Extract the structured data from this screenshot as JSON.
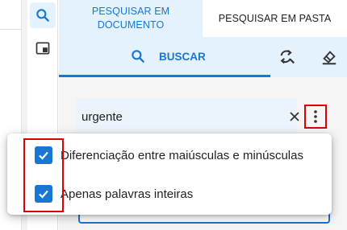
{
  "tabs": [
    {
      "label": "PESQUISAR EM DOCUMENTO",
      "active": true
    },
    {
      "label": "PESQUISAR EM PASTA",
      "active": false
    }
  ],
  "toolbar": {
    "search_label": "BUSCAR",
    "replace_icon": "find-replace-icon",
    "clear_icon": "eraser-icon"
  },
  "search": {
    "value": "urgente"
  },
  "options_menu": {
    "items": [
      {
        "label": "Diferenciação entre maiúsculas e minúsculas",
        "checked": true
      },
      {
        "label": "Apenas palavras inteiras",
        "checked": true
      }
    ]
  },
  "colors": {
    "accent": "#1976d2",
    "active_tab_bg": "#e3f2fd",
    "highlight": "#e00000"
  }
}
